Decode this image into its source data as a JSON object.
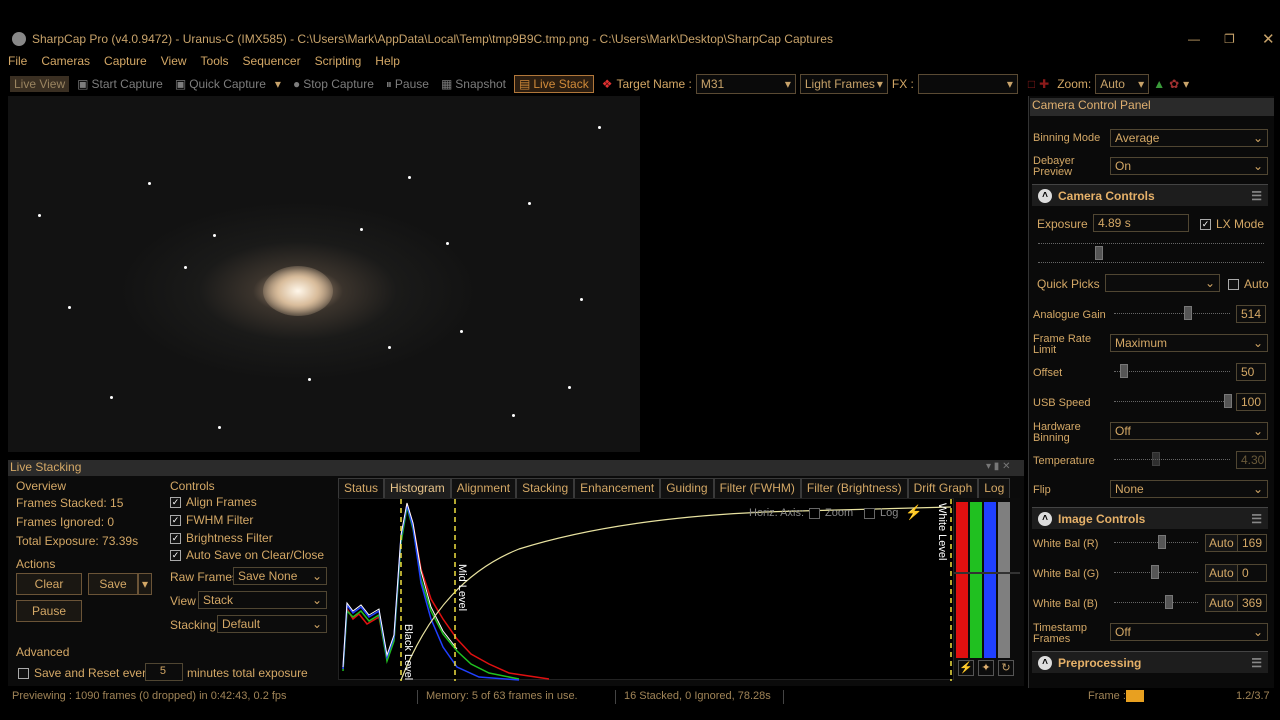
{
  "window": {
    "title": "SharpCap Pro (v4.0.9472) - Uranus-C (IMX585) - C:\\Users\\Mark\\AppData\\Local\\Temp\\tmp9B9C.tmp.png - C:\\Users\\Mark\\Desktop\\SharpCap Captures"
  },
  "menu": [
    "File",
    "Cameras",
    "Capture",
    "View",
    "Tools",
    "Sequencer",
    "Scripting",
    "Help"
  ],
  "toolbar": {
    "live_view": "Live View",
    "start_capture": "Start Capture",
    "quick_capture": "Quick Capture",
    "stop_capture": "Stop Capture",
    "pause": "Pause",
    "snapshot": "Snapshot",
    "live_stack": "Live Stack",
    "target_name_label": "Target Name :",
    "target_name_value": "M31",
    "frame_type": "Light Frames",
    "fx_label": "FX :",
    "fx_value": "",
    "zoom_label": "Zoom:",
    "zoom_value": "Auto"
  },
  "camera_panel": {
    "header": "Camera Control Panel",
    "binning_mode_label": "Binning Mode",
    "binning_mode_value": "Average",
    "debayer_label_1": "Debayer",
    "debayer_label_2": "Preview",
    "debayer_value": "On",
    "camera_controls_title": "Camera Controls",
    "exposure_label": "Exposure",
    "exposure_value": "4.89 s",
    "lx_mode_label": "LX Mode",
    "quick_picks_label": "Quick Picks",
    "quick_picks_value": "",
    "auto_label": "Auto",
    "analogue_gain_label": "Analogue Gain",
    "analogue_gain_value": "514",
    "frame_rate_label_1": "Frame Rate",
    "frame_rate_label_2": "Limit",
    "frame_rate_value": "Maximum",
    "offset_label": "Offset",
    "offset_value": "50",
    "usb_speed_label": "USB Speed",
    "usb_speed_value": "100",
    "hw_binning_label_1": "Hardware",
    "hw_binning_label_2": "Binning",
    "hw_binning_value": "Off",
    "temperature_label": "Temperature",
    "temperature_value": "4.30",
    "flip_label": "Flip",
    "flip_value": "None",
    "image_controls_title": "Image Controls",
    "wb_r_label": "White Bal (R)",
    "wb_r_auto": "Auto",
    "wb_r_value": "169",
    "wb_g_label": "White Bal (G)",
    "wb_g_auto": "Auto",
    "wb_g_value": "0",
    "wb_b_label": "White Bal (B)",
    "wb_b_auto": "Auto",
    "wb_b_value": "369",
    "timestamp_label_1": "Timestamp",
    "timestamp_label_2": "Frames",
    "timestamp_value": "Off",
    "preprocessing_title": "Preprocessing"
  },
  "live_stacking": {
    "header": "Live Stacking",
    "overview_title": "Overview",
    "frames_stacked": "Frames Stacked: 15",
    "frames_ignored": "Frames Ignored: 0",
    "total_exposure": "Total Exposure:   73.39s",
    "actions_title": "Actions",
    "clear": "Clear",
    "save": "Save",
    "pause": "Pause",
    "advanced_title": "Advanced",
    "save_reset": "Save and Reset every",
    "save_reset_value": "5",
    "minutes_total": "minutes total exposure",
    "controls_title": "Controls",
    "align_frames": "Align Frames",
    "fwhm_filter": "FWHM Filter",
    "brightness_filter": "Brightness Filter",
    "auto_save": "Auto Save on Clear/Close",
    "raw_frames_label": "Raw Frames",
    "raw_frames_value": "Save None",
    "view_label": "View",
    "view_value": "Stack",
    "stacking_label": "Stacking",
    "stacking_value": "Default",
    "tabs": [
      "Status",
      "Histogram",
      "Alignment",
      "Stacking",
      "Enhancement",
      "Guiding",
      "Filter (FWHM)",
      "Filter (Brightness)",
      "Drift Graph",
      "Log"
    ],
    "horiz_axis": "Horiz. Axis:",
    "zoom": "Zoom",
    "log": "Log",
    "black_level": "Black Level",
    "mid_level": "Mid Level",
    "white_level": "White Level"
  },
  "status": {
    "previewing": "Previewing : 1090 frames (0 dropped) in 0:42:43, 0.2 fps",
    "memory": "Memory: 5 of 63 frames in use.",
    "stacked": "16 Stacked, 0 Ignored, 78.28s",
    "frame_label": "Frame :",
    "frame_value": "1.2/3.7"
  },
  "colors": {
    "accent": "#d4a866",
    "red": "#e01010",
    "green": "#20c020",
    "blue": "#2040ff",
    "curve": "#e8e2a0"
  }
}
